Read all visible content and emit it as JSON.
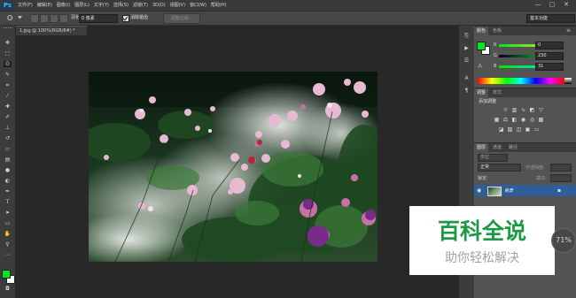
{
  "app": {
    "logo": "Ps"
  },
  "menubar": {
    "items": [
      "文件(F)",
      "编辑(E)",
      "图像(I)",
      "图层(L)",
      "文字(Y)",
      "选择(S)",
      "滤镜(T)",
      "3D(D)",
      "视图(V)",
      "窗口(W)",
      "帮助(H)"
    ]
  },
  "window_controls": {
    "minimize": "—",
    "restore": "▢",
    "close": "✕"
  },
  "options": {
    "feather_label": "羽化:",
    "feather_value": "0 像素",
    "antialias_label": "消除锯齿",
    "antialias_checked": true,
    "refine_edge_label": "调整边缘...",
    "workspace": "基本功能"
  },
  "document": {
    "tab_title": "1.jpg @ 100%(RGB/8#) *"
  },
  "color_panel": {
    "tabs": [
      "颜色",
      "色板"
    ],
    "channels": [
      {
        "label": "R",
        "value": "0"
      },
      {
        "label": "G",
        "value": "230"
      },
      {
        "label": "B",
        "value": "31"
      }
    ],
    "foreground": "#00e61f",
    "background": "#ffffff"
  },
  "adjustments_panel": {
    "tabs": [
      "调整",
      "样式"
    ],
    "add_label": "添加调整"
  },
  "layers_panel": {
    "tabs": [
      "图层",
      "通道",
      "路径"
    ],
    "kind_label": "类型",
    "blend_mode": "正常",
    "opacity_label": "不透明度:",
    "lock_label": "锁定:",
    "fill_label": "填充:",
    "layer_name": "背景"
  },
  "overlay": {
    "brand": "百科全说",
    "slogan": "助你轻松解决",
    "zoom_badge": "71%"
  }
}
